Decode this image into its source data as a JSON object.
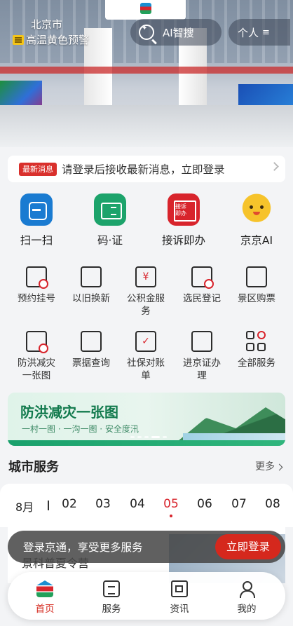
{
  "header": {
    "city": "北京市",
    "weather_warning": "高温黄色预警",
    "ai_search_label": "AI智搜",
    "personal_label": "个人",
    "menu_glyph": "≡"
  },
  "notice": {
    "badge": "最新消息",
    "text": "请登录后接收最新消息，立即登录"
  },
  "top_features": [
    {
      "label": "扫一扫",
      "icon": "scan-icon"
    },
    {
      "label": "码·证",
      "icon": "id-card-icon"
    },
    {
      "label": "接诉即办",
      "icon": "complaint-icon"
    },
    {
      "label": "京京AI",
      "icon": "mascot-icon"
    }
  ],
  "services": [
    {
      "label": "预约挂号",
      "icon": "calendar-clock-icon"
    },
    {
      "label": "以旧换新",
      "icon": "exchange-icon"
    },
    {
      "label": "公积金服务",
      "icon": "housing-fund-icon"
    },
    {
      "label": "选民登记",
      "icon": "ballot-box-icon"
    },
    {
      "label": "景区购票",
      "icon": "ticket-icon"
    },
    {
      "label": "防洪减灾一张图",
      "icon": "flood-map-icon"
    },
    {
      "label": "票据查询",
      "icon": "receipt-search-icon"
    },
    {
      "label": "社保对账单",
      "icon": "social-security-icon"
    },
    {
      "label": "进京证办理",
      "icon": "beijing-permit-icon"
    },
    {
      "label": "全部服务",
      "icon": "all-services-icon"
    }
  ],
  "banner": {
    "title": "防洪减灾一张图",
    "subtitle": "一村一图 · 一沟一图 · 安全度汛"
  },
  "city_services": {
    "title": "城市服务",
    "more_label": "更多",
    "month": "8月",
    "days": [
      "02",
      "03",
      "04",
      "05",
      "06",
      "07",
      "08"
    ],
    "selected_day": "05",
    "card_title": "景科普夏令营"
  },
  "login_toast": {
    "message": "登录京通，享受更多服务",
    "button": "立即登录"
  },
  "tabbar": [
    {
      "label": "首页",
      "active": true
    },
    {
      "label": "服务",
      "active": false
    },
    {
      "label": "资讯",
      "active": false
    },
    {
      "label": "我的",
      "active": false
    }
  ],
  "colors": {
    "accent": "#d5281d",
    "primary_blue": "#1a7bd1",
    "primary_green": "#1ca36b"
  }
}
